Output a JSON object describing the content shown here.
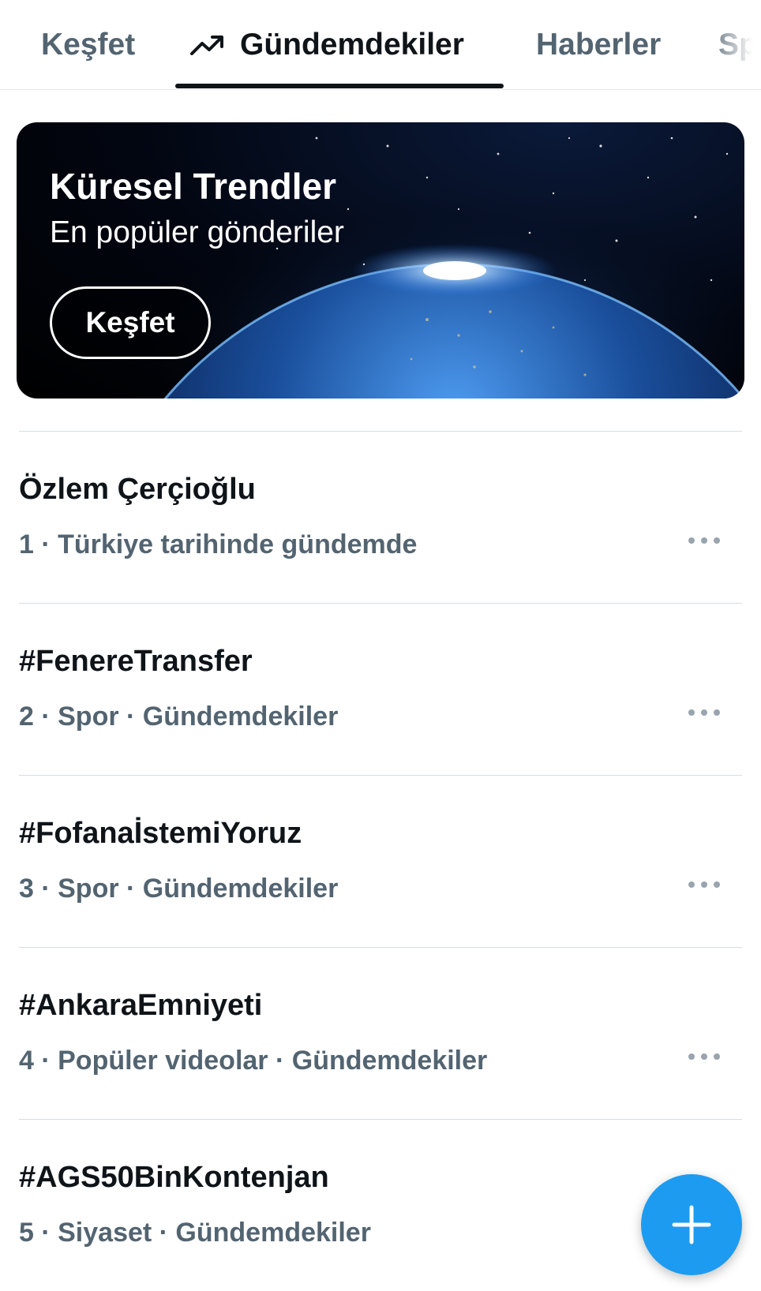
{
  "tabs": [
    {
      "label": "Keşfet",
      "active": false
    },
    {
      "label": "Gündemdekiler",
      "active": true,
      "icon": "trending-arrow-icon"
    },
    {
      "label": "Haberler",
      "active": false
    },
    {
      "label": "Sp",
      "active": false
    }
  ],
  "banner": {
    "title": "Küresel Trendler",
    "subtitle": "En popüler gönderiler",
    "button_label": "Keşfet",
    "image": "earth-from-space"
  },
  "trends": [
    {
      "name": "Özlem Çerçioğlu",
      "meta": "1 · Türkiye tarihinde gündemde"
    },
    {
      "name": "#FenereTransfer",
      "meta": "2 · Spor · Gündemdekiler"
    },
    {
      "name": "#FofanaİstemiYoruz",
      "meta": "3 · Spor · Gündemdekiler"
    },
    {
      "name": "#AnkaraEmniyeti",
      "meta": "4 · Popüler videolar · Gündemdekiler"
    },
    {
      "name": "#AGS50BinKontenjan",
      "meta": "5 · Siyaset · Gündemdekiler"
    }
  ],
  "fab": {
    "icon": "plus-icon"
  },
  "colors": {
    "accent": "#1d9bf0",
    "text": "#0f1419",
    "secondary": "#536471"
  }
}
